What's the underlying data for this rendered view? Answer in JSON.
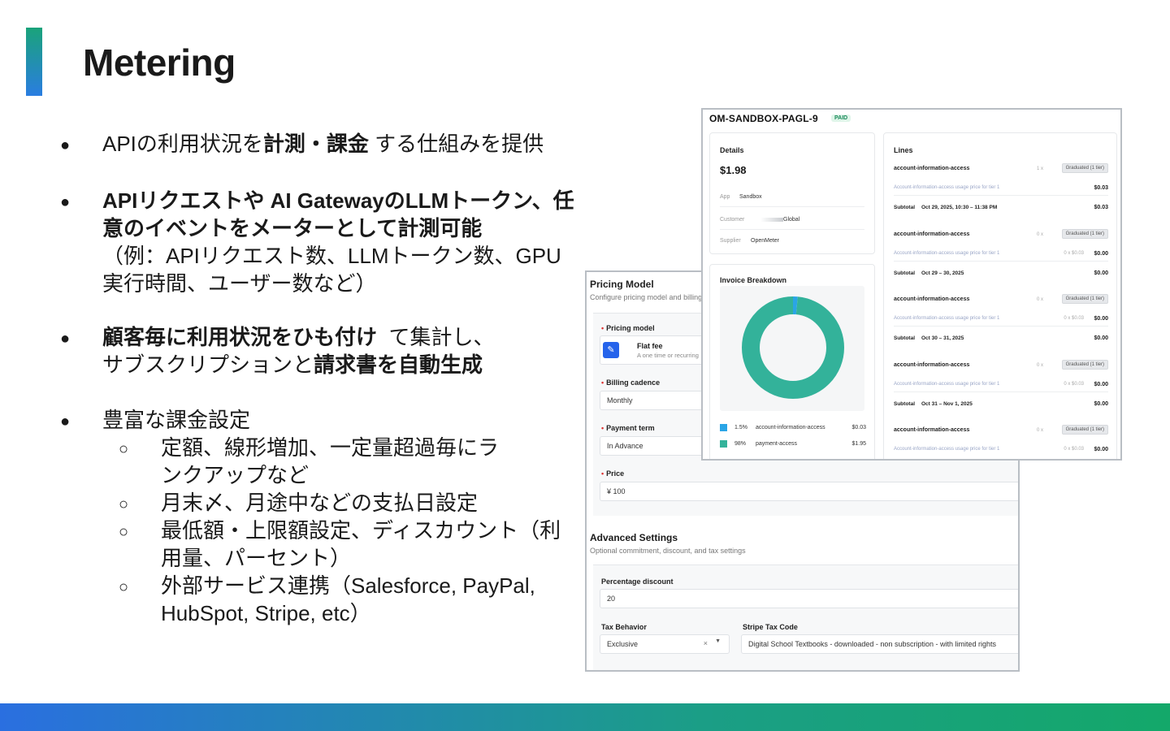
{
  "slide": {
    "title": "Metering"
  },
  "bullets": {
    "b1": {
      "pre": "APIの利用状況を",
      "bold": "計測・課金",
      "post": "する仕組みを提供"
    },
    "b2": {
      "bold": "APIリクエストや AI GatewayのLLMトークン、任意のイベントをメーターとして計測可能",
      "note": "（例：APIリクエスト数、LLMトークン数、GPU実行時間、ユーザー数など）"
    },
    "b3": {
      "bold1": "顧客毎に利用状況をひも付け",
      "mid": "て集計し、",
      "pre2": "サブスクリプションと",
      "bold2": "請求書を自動生成"
    },
    "b4": {
      "text": "豊富な課金設定",
      "subs": [
        "定額、線形増加、一定量超過毎にランクアップなど",
        "月末〆、月途中などの支払日設定",
        "最低額・上限額設定、ディスカウント（利用量、パーセント）",
        "外部サービス連携（Salesforce, PayPal, HubSpot, Stripe, etc）"
      ]
    },
    "bullet_char": "●",
    "sub_char": "○"
  },
  "pricing_panel": {
    "title": "Pricing Model",
    "desc": "Configure pricing model and billing",
    "pricing_model_label": "Pricing model",
    "flat_fee": "Flat fee",
    "flat_fee_desc": "A one time or recurring",
    "billing_cadence_label": "Billing cadence",
    "billing_cadence": "Monthly",
    "payment_term_label": "Payment term",
    "payment_term": "In Advance",
    "price_label": "Price",
    "price": "¥  100",
    "advanced_title": "Advanced Settings",
    "advanced_desc": "Optional commitment, discount, and tax settings",
    "percentage_discount_label": "Percentage discount",
    "percentage_discount": "20",
    "tax_behavior_label": "Tax Behavior",
    "tax_behavior": "Exclusive",
    "stripe_tax_label": "Stripe Tax Code",
    "stripe_tax": "Digital School Textbooks - downloaded - non subscription - with limited rights"
  },
  "invoice_panel": {
    "title": "OM-SANDBOX-PAGL-9",
    "badge": "PAID",
    "details": {
      "heading": "Details",
      "amount": "$1.98",
      "app_label": "App",
      "app": "Sandbox",
      "customer_label": "Customer",
      "customer": "Global",
      "supplier_label": "Supplier",
      "supplier": "OpenMeter"
    },
    "breakdown": {
      "heading": "Invoice Breakdown",
      "items": [
        {
          "pct": "1.5%",
          "name": "account-information-access",
          "amount": "$0.03",
          "color": "#2aa5e6",
          "value": 1.5
        },
        {
          "pct": "98%",
          "name": "payment-access",
          "amount": "$1.95",
          "color": "#33b29a",
          "value": 98.5
        }
      ]
    },
    "lines_heading": "Lines",
    "lines": [
      {
        "name": "account-information-access",
        "qty": "1 x",
        "badge": "Graduated (1 tier)",
        "desc": "Account-information-access usage price for tier 1",
        "price": "",
        "amount": "$0.03",
        "subtotal_label": "Subtotal",
        "period": "Oct 29, 2025, 10:30 – 11:38 PM",
        "subtotal": "$0.03"
      },
      {
        "name": "account-information-access",
        "qty": "0 x",
        "badge": "Graduated (1 tier)",
        "desc": "Account-information-access usage price for tier 1",
        "price": "0 x $0.03",
        "amount": "$0.00",
        "subtotal_label": "Subtotal",
        "period": "Oct 29 – 30, 2025",
        "subtotal": "$0.00"
      },
      {
        "name": "account-information-access",
        "qty": "0 x",
        "badge": "Graduated (1 tier)",
        "desc": "Account-information-access usage price for tier 1",
        "price": "0 x $0.03",
        "amount": "$0.00",
        "subtotal_label": "Subtotal",
        "period": "Oct 30 – 31, 2025",
        "subtotal": "$0.00"
      },
      {
        "name": "account-information-access",
        "qty": "0 x",
        "badge": "Graduated (1 tier)",
        "desc": "Account-information-access usage price for tier 1",
        "price": "0 x $0.03",
        "amount": "$0.00",
        "subtotal_label": "Subtotal",
        "period": "Oct 31 – Nov 1, 2025",
        "subtotal": "$0.00"
      },
      {
        "name": "account-information-access",
        "qty": "0 x",
        "badge": "Graduated (1 tier)",
        "desc": "Account-information-access usage price for tier 1",
        "price": "0 x $0.03",
        "amount": "$0.00",
        "subtotal_label": "",
        "period": "",
        "subtotal": ""
      }
    ]
  }
}
